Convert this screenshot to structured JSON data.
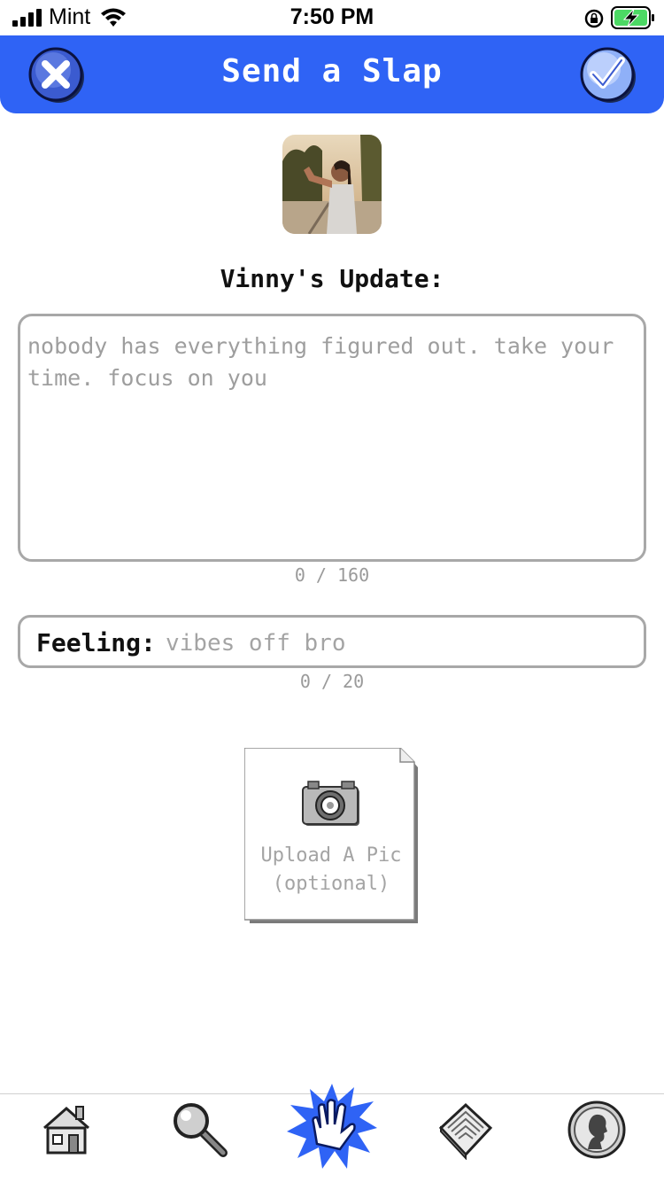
{
  "status_bar": {
    "carrier": "Mint",
    "time": "7:50 PM"
  },
  "nav": {
    "title": "Send a Slap",
    "close_icon": "close-icon",
    "confirm_icon": "checkmark-icon",
    "accent_color": "#2f63f5"
  },
  "profile": {
    "update_label": "Vinny's Update:"
  },
  "update": {
    "placeholder": "nobody has everything figured out. take your time. focus on you",
    "counter": "0 / 160"
  },
  "feeling": {
    "label": "Feeling:",
    "placeholder": "vibes off bro",
    "counter": "0 / 20"
  },
  "upload": {
    "line1": "Upload A Pic",
    "line2": "(optional)"
  },
  "tabs": [
    {
      "icon": "home-icon"
    },
    {
      "icon": "search-icon"
    },
    {
      "icon": "slap-hand-icon"
    },
    {
      "icon": "newspaper-icon"
    },
    {
      "icon": "profile-icon"
    }
  ]
}
